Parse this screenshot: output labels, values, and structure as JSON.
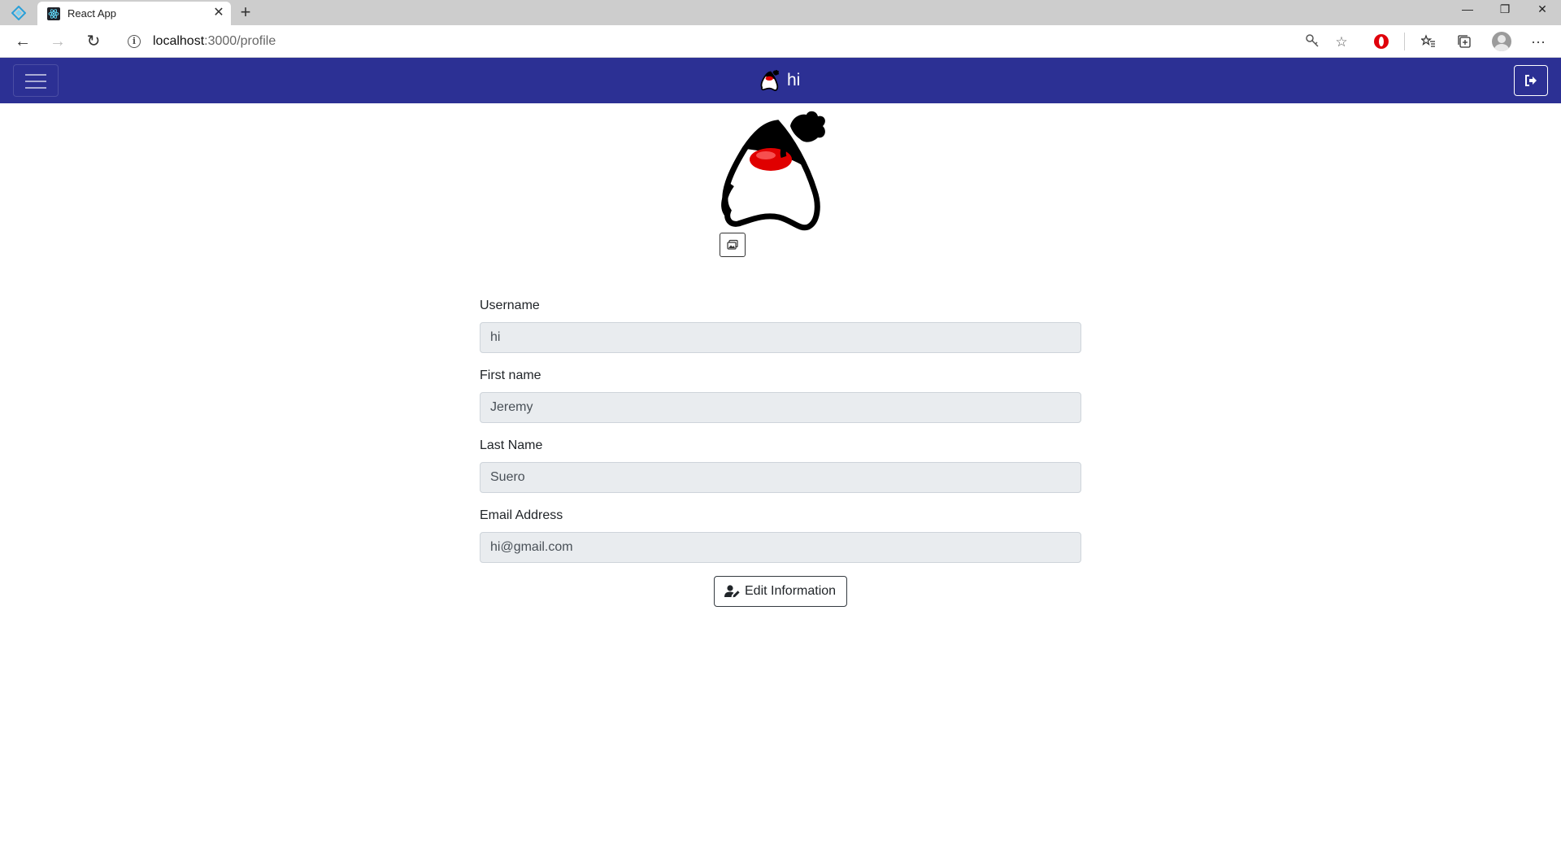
{
  "browser": {
    "tab_title": "React App",
    "tab_close": "✕",
    "new_tab": "+",
    "url_host": "localhost",
    "url_path": ":3000/profile",
    "window_controls": {
      "minimize": "—",
      "restore": "❐",
      "close": "✕"
    },
    "icons": {
      "app": "edge-dev-icon",
      "favicon": "react-icon",
      "back": "back-arrow-icon",
      "forward": "forward-arrow-icon",
      "refresh": "refresh-icon",
      "info": "info-icon",
      "key": "key-icon",
      "star": "star-icon",
      "extension": "opera-icon",
      "favorites": "favorites-icon",
      "collections": "collections-icon",
      "profile": "profile-icon",
      "menu": "more-icon"
    }
  },
  "navbar": {
    "background": "#2c3094",
    "brand_name": "hi"
  },
  "profile": {
    "fields": [
      {
        "label": "Username",
        "value": "hi"
      },
      {
        "label": "First name",
        "value": "Jeremy"
      },
      {
        "label": "Last Name",
        "value": "Suero"
      },
      {
        "label": "Email Address",
        "value": "hi@gmail.com"
      }
    ],
    "edit_button_label": "Edit Information"
  }
}
